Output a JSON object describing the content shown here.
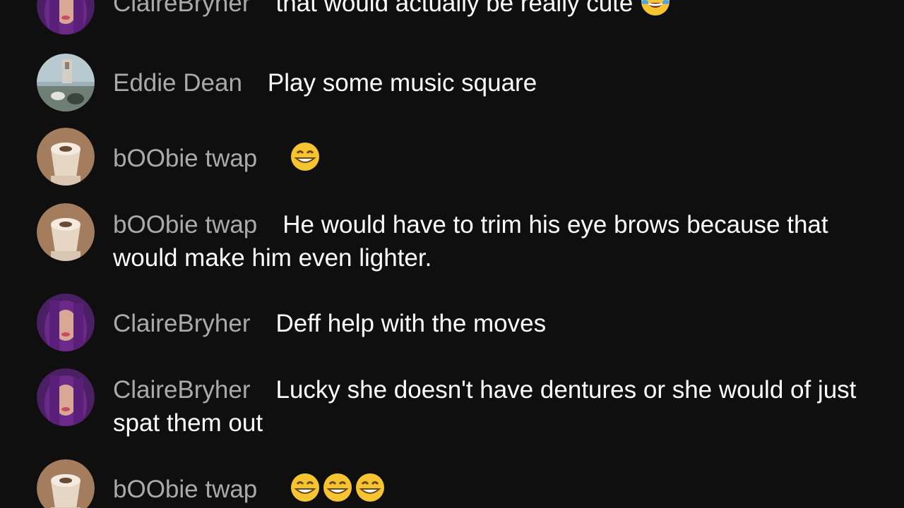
{
  "chat": {
    "messages": [
      {
        "author": "ClaireBryher",
        "avatar": "avatar-claire",
        "text": "that would actually be really cute",
        "emojis": [
          "tears-of-joy"
        ]
      },
      {
        "author": "Eddie Dean",
        "avatar": "avatar-eddie",
        "text": "Play some music square",
        "emojis": []
      },
      {
        "author": "bOObie twap",
        "avatar": "avatar-boobie",
        "text": "",
        "emojis": [
          "grinning-face"
        ]
      },
      {
        "author": "bOObie twap",
        "avatar": "avatar-boobie",
        "text": "He would have to trim his eye brows because that would make him even lighter.",
        "emojis": []
      },
      {
        "author": "ClaireBryher",
        "avatar": "avatar-claire",
        "text": "Deff help with the moves",
        "emojis": []
      },
      {
        "author": "ClaireBryher",
        "avatar": "avatar-claire",
        "text": "Lucky she doesn't have dentures or she would of just spat them out",
        "emojis": []
      },
      {
        "author": "bOObie twap",
        "avatar": "avatar-boobie",
        "text": "",
        "emojis": [
          "grinning-face",
          "grinning-face",
          "grinning-face"
        ]
      }
    ]
  },
  "colors": {
    "background": "#0f0f0f",
    "author": "#aaaaaa",
    "message": "#ffffff"
  }
}
